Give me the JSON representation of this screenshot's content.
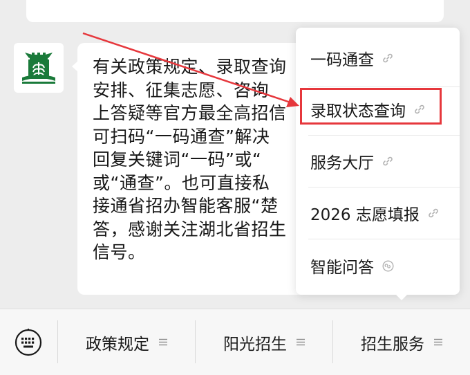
{
  "message": {
    "lines": [
      "有关政策规定、录取查询",
      "安排、征集志愿、咨询",
      "上答疑等官方最全高招信",
      "可扫码“一码通查”解决",
      "回复关键词“一码”或“",
      "或“通查”。也可直接私",
      "接通省招办智能客服“楚",
      "答，感谢关注湖北省招生",
      "信号。"
    ]
  },
  "popup_menu": {
    "items": [
      {
        "label": "一码通查",
        "icon": "link-icon"
      },
      {
        "label": "录取状态查询",
        "icon": "link-icon",
        "highlighted": true
      },
      {
        "label": "服务大厅",
        "icon": "link-icon"
      },
      {
        "label": "2026 志愿填报",
        "icon": "link-icon"
      },
      {
        "label": "智能问答",
        "icon": "miniprogram-icon"
      }
    ]
  },
  "bottom_menu": {
    "keyboard_icon": "keyboard-icon",
    "buttons": [
      {
        "label": "政策规定",
        "icon": "hamburger-icon"
      },
      {
        "label": "阳光招生",
        "icon": "hamburger-icon"
      },
      {
        "label": "招生服务",
        "icon": "hamburger-icon"
      }
    ]
  },
  "colors": {
    "background": "#ededed",
    "bubble": "#ffffff",
    "highlight": "#e6373c",
    "logo_green": "#1a7a3a",
    "text": "#191919"
  }
}
